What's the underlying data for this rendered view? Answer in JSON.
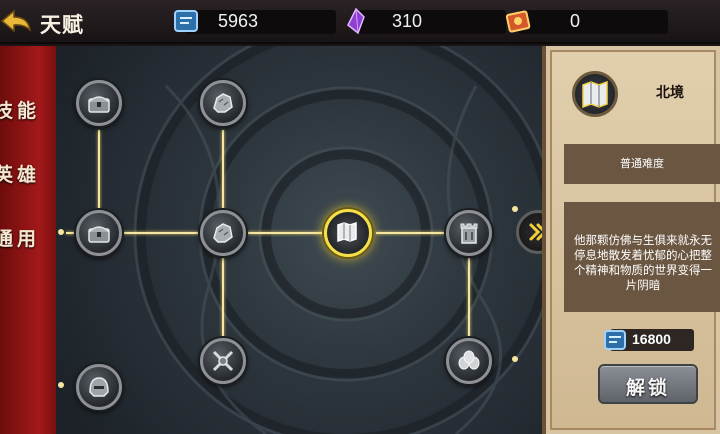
{
  "header": {
    "title": "天赋",
    "back_icon": "back-arrow-icon"
  },
  "resources": [
    {
      "name": "scroll",
      "icon": "blue-scroll-icon",
      "value": "5963"
    },
    {
      "name": "crystal",
      "icon": "purple-crystal-icon",
      "value": "310"
    },
    {
      "name": "ticket",
      "icon": "red-ticket-icon",
      "value": "0"
    }
  ],
  "tabs": [
    {
      "label": "技能"
    },
    {
      "label": "英雄"
    },
    {
      "label": "通用",
      "selected": true
    }
  ],
  "talent_nodes": [
    {
      "id": "r1c1",
      "icon": "chest-icon"
    },
    {
      "id": "r1c2",
      "icon": "stone-icon"
    },
    {
      "id": "r2c1",
      "icon": "chest-icon"
    },
    {
      "id": "r2c2",
      "icon": "stone-icon"
    },
    {
      "id": "r2c3",
      "icon": "map-scroll-icon",
      "selected": true
    },
    {
      "id": "r2c4",
      "icon": "tower-icon"
    },
    {
      "id": "r3c2",
      "icon": "crossed-swords-icon"
    },
    {
      "id": "r3c4",
      "icon": "eggs-icon"
    },
    {
      "id": "r4c1",
      "icon": "helmet-icon"
    }
  ],
  "detail": {
    "icon": "map-scroll-icon",
    "title": "北境",
    "difficulty": "普通难度",
    "description": "他那颗仿佛与生俱来就永无停息地散发着忧郁的心把整个精神和物质的世界变得一片阴暗",
    "cost_icon": "blue-scroll-icon",
    "cost": "16800",
    "unlock_label": "解锁"
  },
  "colors": {
    "path": "#f5e7a0",
    "selected_ring": "#f6e04a",
    "tab_red": "#a3191a",
    "panel_parchment": "#d7c4a3"
  }
}
